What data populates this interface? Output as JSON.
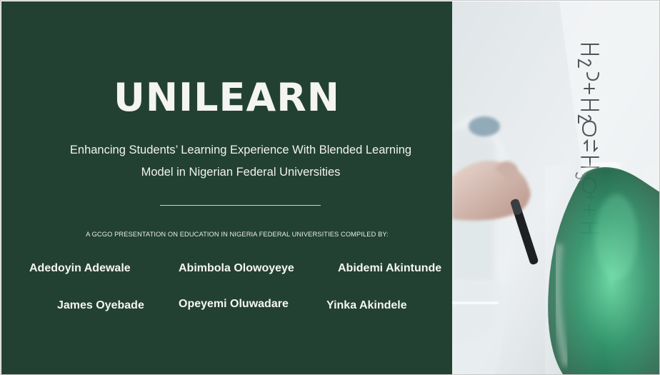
{
  "slide": {
    "title": "UNILEARN",
    "subtitle_line1": "Enhancing Students’ Learning Experience With Blended Learning",
    "subtitle_line2": "Model in Nigerian Federal Universities",
    "compiled_by": "A GCGO PRESENTATION ON EDUCATION IN NIGERIA FEDERAL UNIVERSITIES COMPILED BY:",
    "authors": [
      "Adedoyin Adewale",
      "Abimbola Olowoyeye",
      "Abidemi Akintunde",
      "James Oyebade",
      "Opeyemi Oluwadare",
      "Yinka Akindele"
    ]
  },
  "photo": {
    "subject": "hand writing chemical equation on whiteboard behind flask of green liquid",
    "board_text": "H3O+ + H2O ⇌ H3O+ + H"
  },
  "colors": {
    "panel_background": "#224132",
    "text": "#f4f4f2",
    "liquid": "#1f8a5c"
  }
}
